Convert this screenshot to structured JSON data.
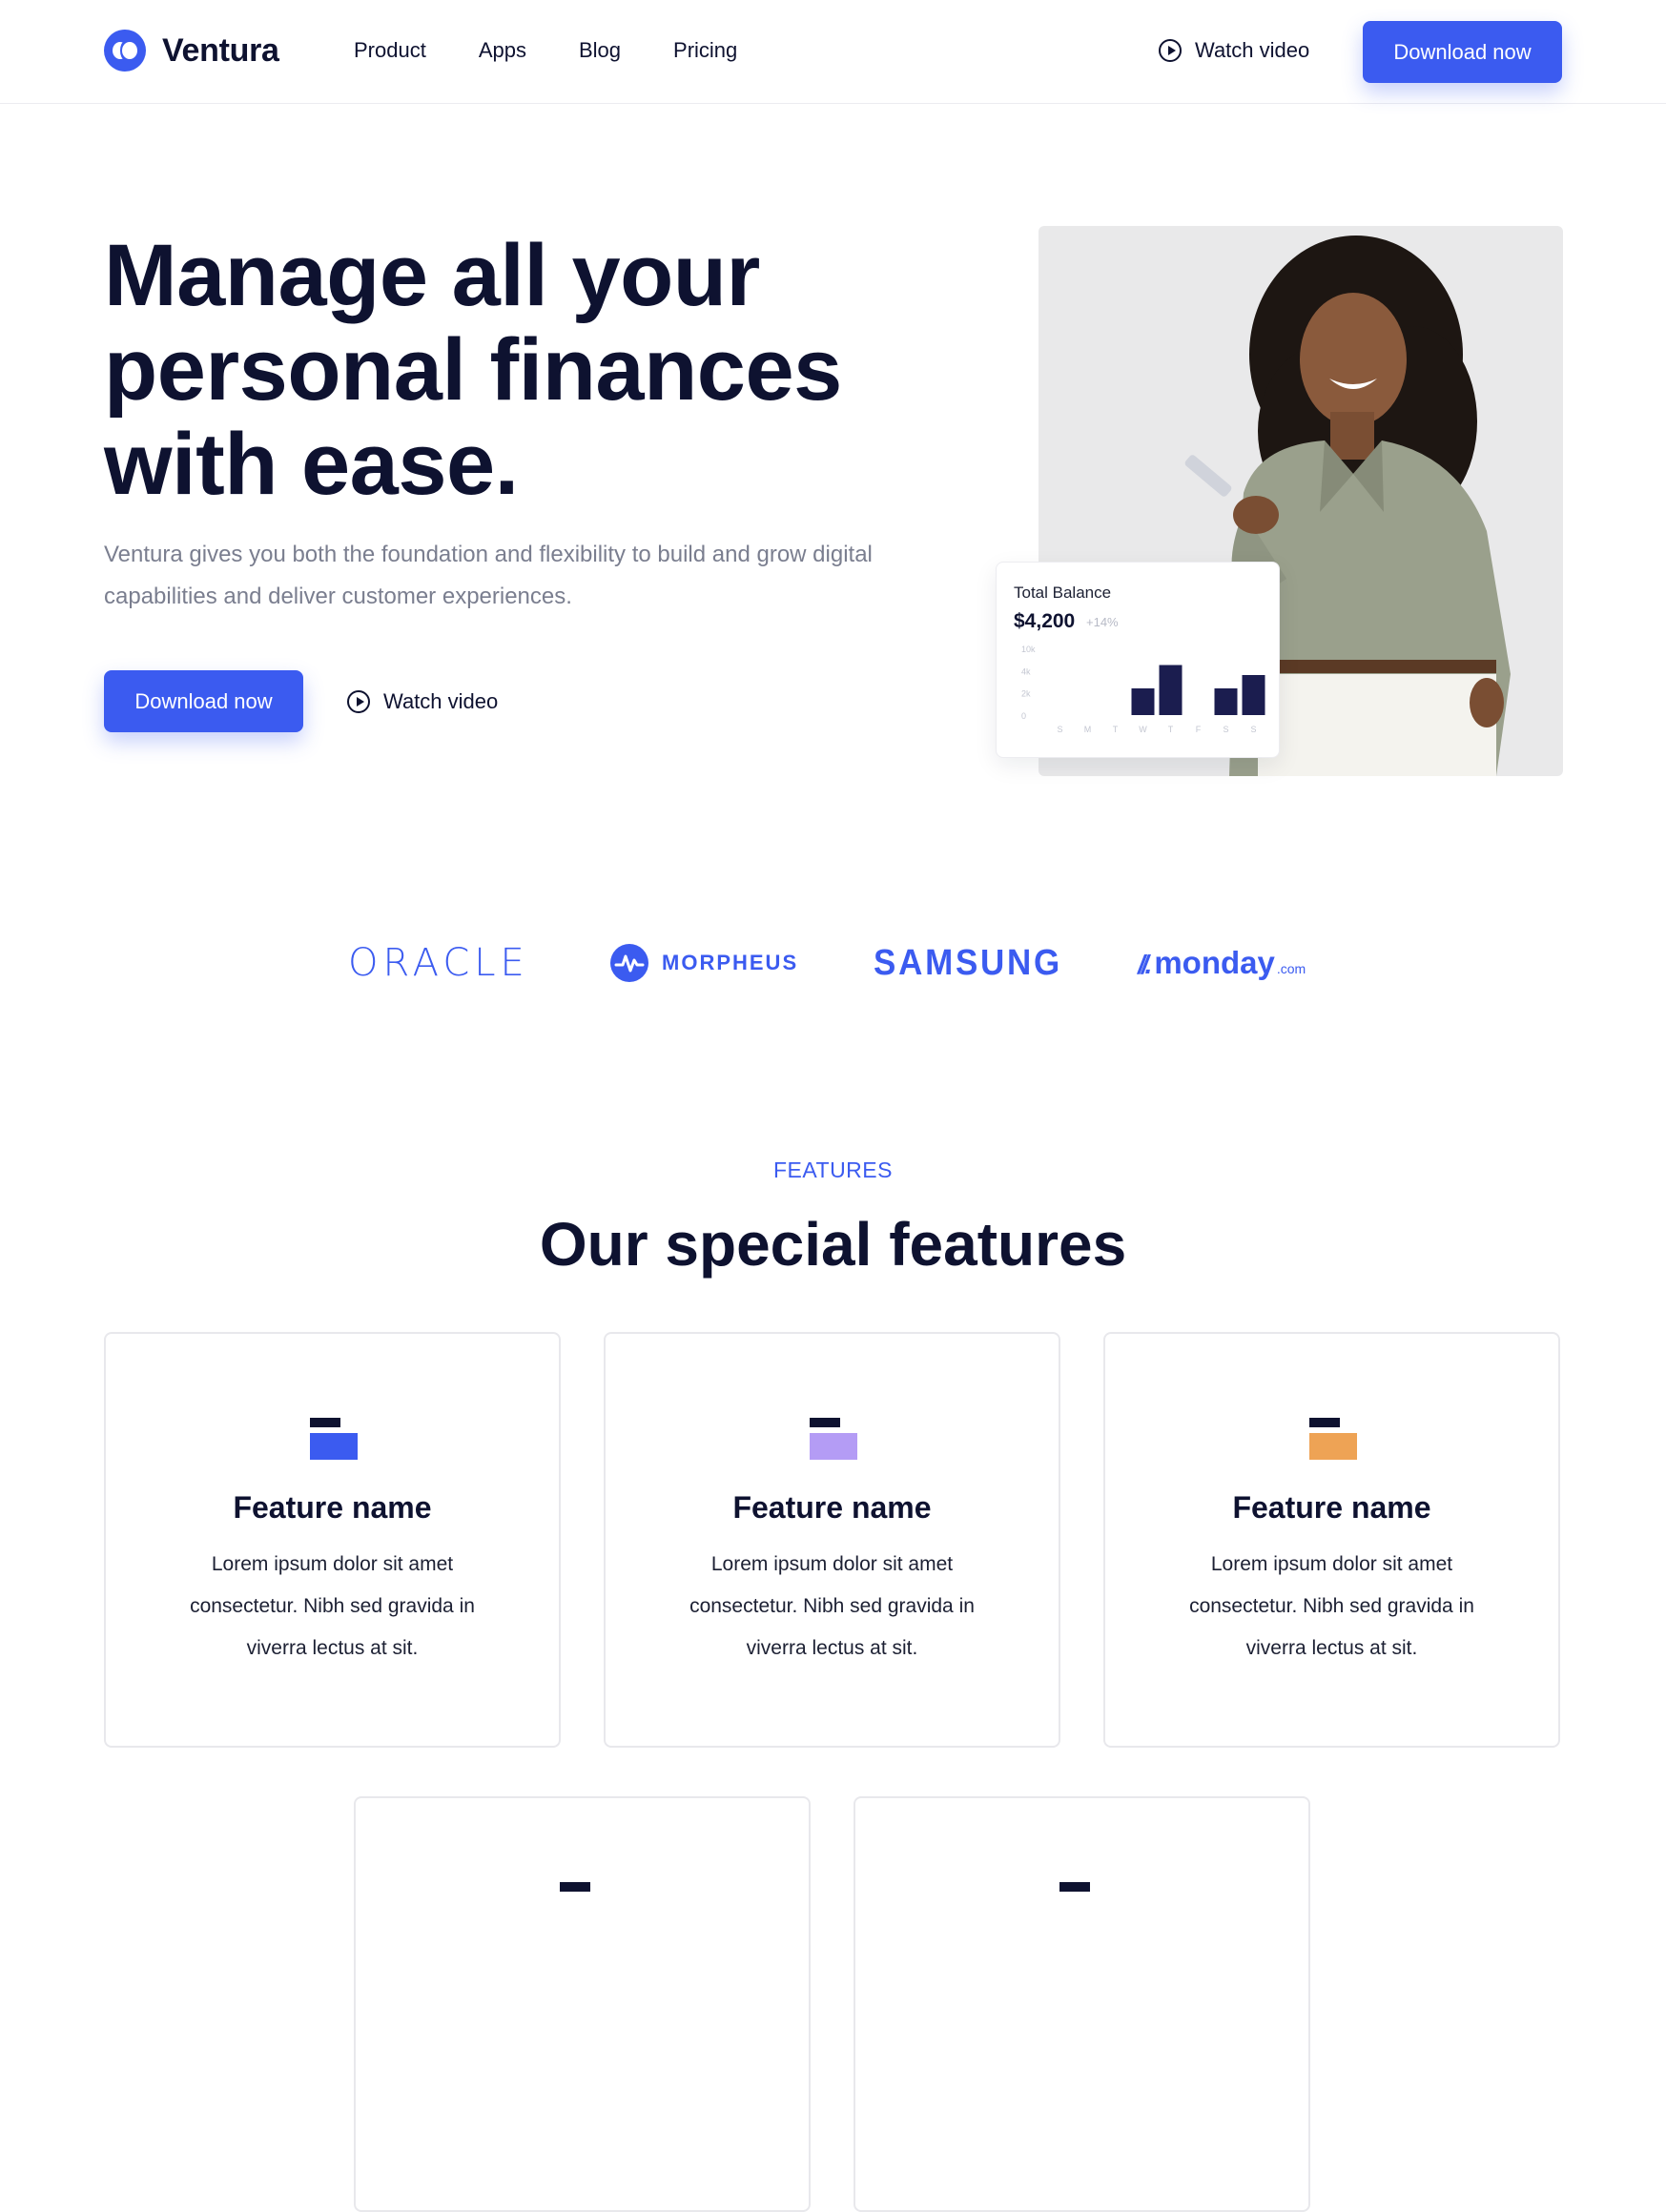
{
  "header": {
    "brand": "Ventura",
    "nav": [
      "Product",
      "Apps",
      "Blog",
      "Pricing"
    ],
    "watch_label": "Watch video",
    "download_label": "Download now"
  },
  "hero": {
    "title_lines": [
      "Manage all your",
      "personal finances",
      "with ease."
    ],
    "subtitle": "Ventura gives you both the foundation and flexibility to build and grow digital capabilities and deliver customer experiences.",
    "download_label": "Download now",
    "watch_label": "Watch video"
  },
  "balance_card": {
    "label": "Total Balance",
    "value": "$4,200",
    "change": "+14%",
    "chart_data": {
      "type": "bar",
      "categories": [
        "S",
        "M",
        "T",
        "W",
        "T",
        "F",
        "S",
        "S"
      ],
      "values": [
        0,
        0,
        0,
        4,
        7.5,
        0,
        4,
        6
      ],
      "ylim": [
        0,
        10
      ],
      "yticks": [
        "10k",
        "4k",
        "2k",
        "0"
      ],
      "bar_color": "#1b1d4f"
    }
  },
  "logos": {
    "oracle": "ORACLE",
    "morpheus": "MORPHEUS",
    "samsung": "SAMSUNG",
    "monday": "monday",
    "monday_suffix": ".com"
  },
  "features": {
    "kicker": "FEATURES",
    "title": "Our special features",
    "cards": [
      {
        "name": "Feature name",
        "desc": "Lorem ipsum dolor sit amet consectetur. Nibh sed gravida in viverra lectus at sit.",
        "accent": "#3b5bf0"
      },
      {
        "name": "Feature name",
        "desc": "Lorem ipsum dolor sit amet consectetur. Nibh sed gravida in viverra lectus at sit.",
        "accent": "#b49cf5"
      },
      {
        "name": "Feature name",
        "desc": "Lorem ipsum dolor sit amet consectetur. Nibh sed gravida in viverra lectus at sit.",
        "accent": "#eea355"
      }
    ]
  },
  "colors": {
    "accent": "#3b5bf0",
    "text_dark": "#0e1230",
    "text_muted": "#7a7e8f"
  }
}
